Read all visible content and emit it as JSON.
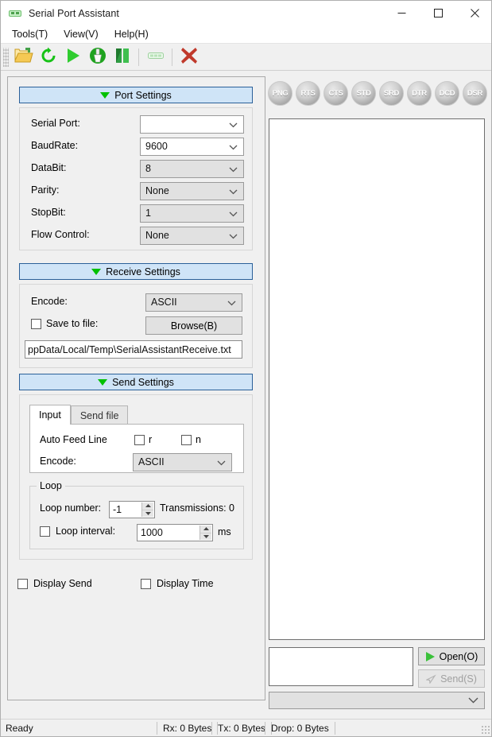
{
  "window": {
    "title": "Serial Port Assistant",
    "icon": "serial-port-icon",
    "minimize_label": "─",
    "maximize_label": "□",
    "close_label": "✕"
  },
  "menubar": {
    "items": [
      {
        "label": "Tools(T)"
      },
      {
        "label": "View(V)"
      },
      {
        "label": "Help(H)"
      }
    ]
  },
  "toolbar": {
    "buttons": [
      {
        "name": "open-file-icon",
        "tooltip": "Open"
      },
      {
        "name": "refresh-icon",
        "tooltip": "Refresh"
      },
      {
        "name": "play-icon",
        "tooltip": "Start"
      },
      {
        "name": "clear-brush-icon",
        "tooltip": "Clear"
      },
      {
        "name": "pause-icon",
        "tooltip": "Pause"
      },
      {
        "name": "serial-port-icon",
        "tooltip": "Port"
      },
      {
        "name": "close-red-x-icon",
        "tooltip": "Close"
      }
    ]
  },
  "port_settings": {
    "header": "Port Settings",
    "fields": [
      {
        "label": "Serial Port:",
        "value": "",
        "editable": true
      },
      {
        "label": "BaudRate:",
        "value": "9600",
        "editable": true
      },
      {
        "label": "DataBit:",
        "value": "8",
        "editable": false
      },
      {
        "label": "Parity:",
        "value": "None",
        "editable": false
      },
      {
        "label": "StopBit:",
        "value": "1",
        "editable": false
      },
      {
        "label": "Flow Control:",
        "value": "None",
        "editable": false
      }
    ]
  },
  "receive_settings": {
    "header": "Receive Settings",
    "encode_label": "Encode:",
    "encode_value": "ASCII",
    "save_to_file_label": "Save to file:",
    "save_to_file_checked": false,
    "browse_label": "Browse(B)",
    "file_path": "ppData/Local/Temp\\SerialAssistantReceive.txt"
  },
  "send_settings": {
    "header": "Send Settings",
    "tabs": [
      {
        "label": "Input",
        "active": true
      },
      {
        "label": "Send file",
        "active": false
      }
    ],
    "auto_feed_line_label": "Auto Feed Line",
    "auto_feed_r_label": "r",
    "auto_feed_r_checked": false,
    "auto_feed_n_label": "n",
    "auto_feed_n_checked": false,
    "encode_label": "Encode:",
    "encode_value": "ASCII",
    "loop": {
      "legend": "Loop",
      "loop_number_label": "Loop number:",
      "loop_number_value": "-1",
      "transmissions_label": "Transmissions: 0",
      "loop_interval_label": "Loop interval:",
      "loop_interval_checked": false,
      "loop_interval_value": "1000",
      "unit_label": "ms"
    }
  },
  "display_options": {
    "display_send_label": "Display Send",
    "display_send_checked": false,
    "display_time_label": "Display Time",
    "display_time_checked": false
  },
  "indicators": {
    "leds": [
      {
        "label": "PNG",
        "on": false
      },
      {
        "label": "RTS",
        "on": false
      },
      {
        "label": "CTS",
        "on": false
      },
      {
        "label": "STD",
        "on": false
      },
      {
        "label": "SRD",
        "on": false
      },
      {
        "label": "DTR",
        "on": false
      },
      {
        "label": "DCD",
        "on": false
      },
      {
        "label": "DSR",
        "on": false
      }
    ]
  },
  "receive_area": {
    "text": ""
  },
  "send_area": {
    "text": ""
  },
  "actions": {
    "open_label": "Open(O)",
    "send_label": "Send(S)",
    "send_enabled": false
  },
  "history": {
    "value": ""
  },
  "statusbar": {
    "state": "Ready",
    "rx": "Rx: 0 Bytes",
    "tx": "Tx: 0 Bytes",
    "drop": "Drop: 0 Bytes"
  },
  "colors": {
    "accent_green": "#00c000",
    "header_blue_bg": "#cfe4f7",
    "header_blue_border": "#2a6099",
    "close_red": "#c0392b"
  }
}
